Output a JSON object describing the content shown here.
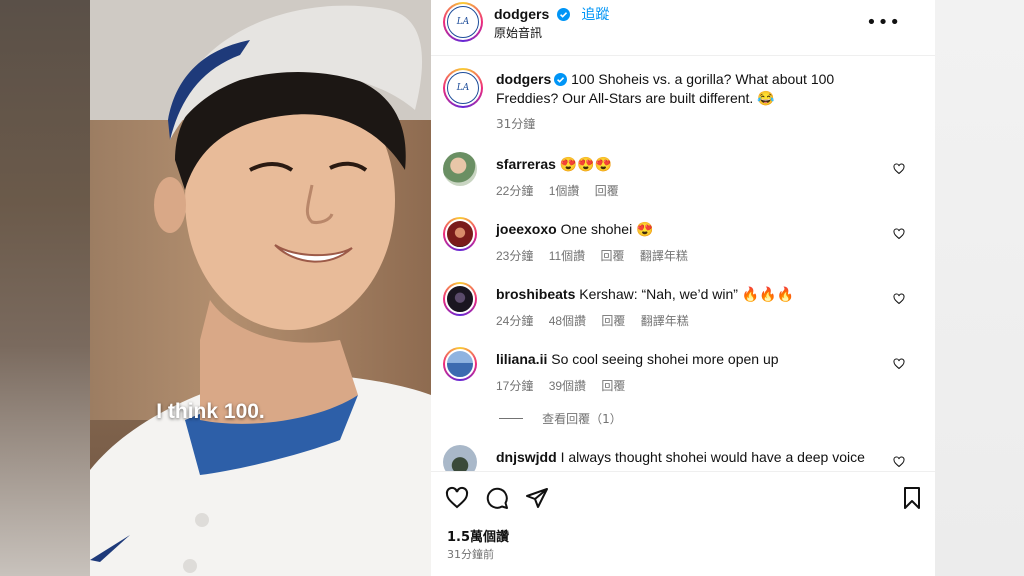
{
  "header": {
    "username": "dodgers",
    "follow_label": "追蹤",
    "audio_label": "原始音訊",
    "more_label": "•••"
  },
  "video": {
    "caption": "I think 100."
  },
  "caption_post": {
    "username": "dodgers",
    "text": "100 Shoheis vs. a gorilla? What about 100 Freddies? Our All-Stars are built different. 😂",
    "time": "31分鐘"
  },
  "comments": [
    {
      "username": "sfarreras",
      "text": "😍😍😍",
      "time": "22分鐘",
      "likes": "1個讚",
      "reply": "回覆",
      "translate": ""
    },
    {
      "username": "joeexoxo",
      "text": "One shohei 😍",
      "time": "23分鐘",
      "likes": "11個讚",
      "reply": "回覆",
      "translate": "翻譯年糕"
    },
    {
      "username": "broshibeats",
      "text": "Kershaw: “Nah, we’d win” 🔥🔥🔥",
      "time": "24分鐘",
      "likes": "48個讚",
      "reply": "回覆",
      "translate": "翻譯年糕"
    },
    {
      "username": "liliana.ii",
      "text": "So cool seeing shohei more open up",
      "time": "17分鐘",
      "likes": "39個讚",
      "reply": "回覆",
      "translate": ""
    },
    {
      "username": "dnjswjdd",
      "text": "I always thought shohei would have a deep voice"
    }
  ],
  "view_replies": "查看回覆（1）",
  "footer": {
    "likes": "1.5萬個讚",
    "time": "31分鐘前"
  },
  "colors": {
    "accent": "#0095f6",
    "verified": "#0095f6",
    "dodger_blue": "#1e4d9a"
  },
  "icons": [
    "heart-icon",
    "comment-icon",
    "share-icon",
    "bookmark-icon",
    "verified-icon",
    "more-icon"
  ]
}
